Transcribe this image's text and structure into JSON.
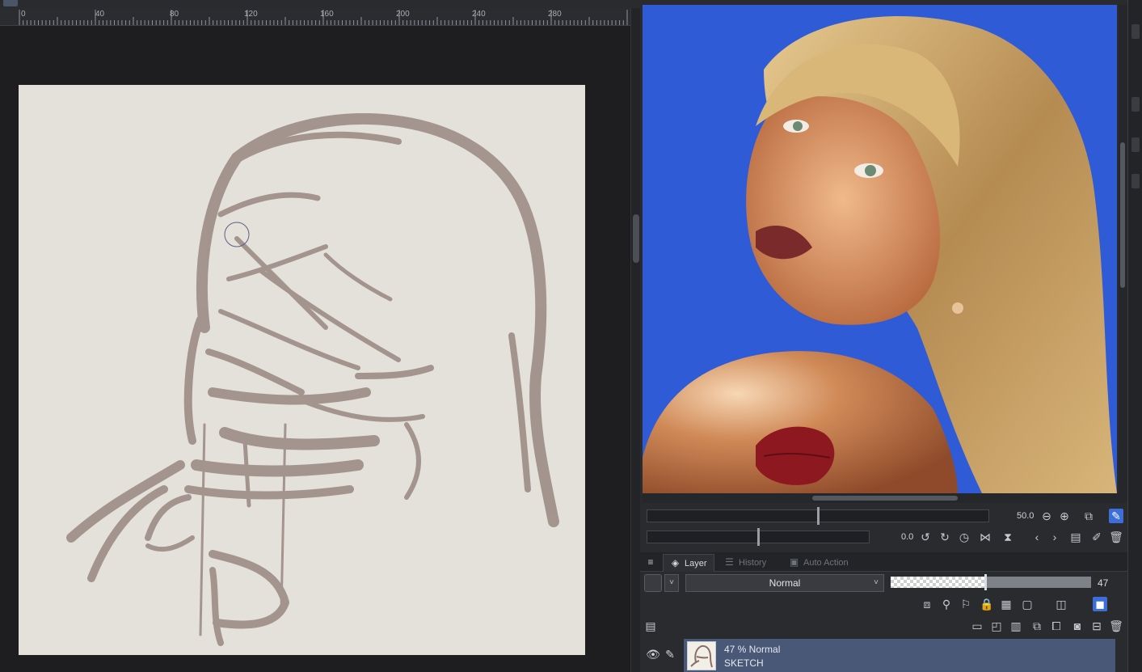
{
  "ruler": {
    "labels": [
      "0",
      "40",
      "80",
      "120",
      "160",
      "200",
      "240",
      "280"
    ]
  },
  "navigator": {
    "zoom_value": "50.0",
    "rotation_value": "0.0"
  },
  "palette": {
    "tabs": [
      {
        "label": "Layer",
        "icon": "layer-stack-icon",
        "active": true
      },
      {
        "label": "History",
        "icon": "history-icon",
        "active": false
      },
      {
        "label": "Auto Action",
        "icon": "auto-action-icon",
        "active": false
      }
    ]
  },
  "layer_props": {
    "blend_mode": "Normal",
    "opacity": 47,
    "opacity_label": "47"
  },
  "layer": {
    "line1": "47 % Normal",
    "line2": "SKETCH"
  },
  "colors": {
    "accent": "#4a5878",
    "sketch_stroke": "#a0918a",
    "reference_sky": "#2f5bd6"
  }
}
